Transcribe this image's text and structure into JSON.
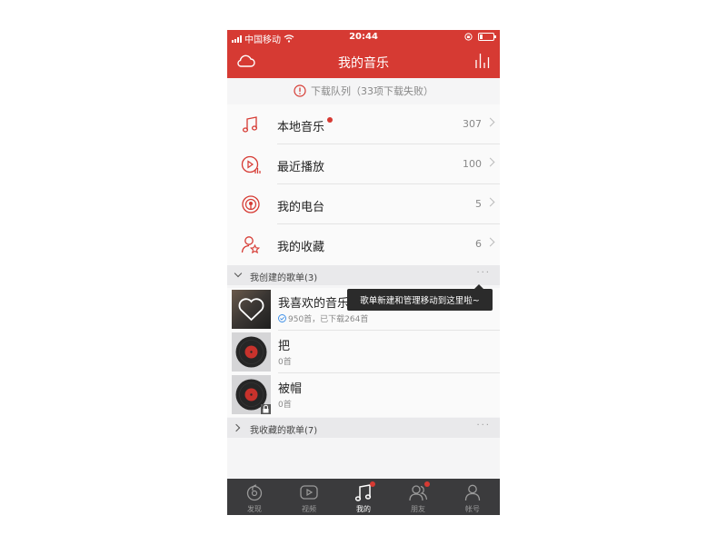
{
  "status_bar": {
    "carrier": "中国移动",
    "time": "20:44"
  },
  "nav": {
    "title": "我的音乐"
  },
  "download_queue": {
    "text": "下载队列（33项下载失败）"
  },
  "menu": [
    {
      "label": "本地音乐",
      "count": "307",
      "icon": "music-note-icon"
    },
    {
      "label": "最近播放",
      "count": "100",
      "icon": "recent-play-icon"
    },
    {
      "label": "我的电台",
      "count": "5",
      "icon": "radio-icon"
    },
    {
      "label": "我的收藏",
      "count": "6",
      "icon": "favorite-user-icon"
    }
  ],
  "created_section": {
    "title": "我创建的歌单(3)",
    "more": "···"
  },
  "tooltip": {
    "text": "歌单新建和管理移动到这里啦~"
  },
  "playlists": [
    {
      "name": "我喜欢的音乐",
      "sub": "950首，已下载264首"
    },
    {
      "name": "把",
      "sub": "0首"
    },
    {
      "name": "被帽",
      "sub": "0首"
    }
  ],
  "collected_section": {
    "title": "我收藏的歌单(7)",
    "more": "···"
  },
  "tabs": [
    {
      "label": "发现",
      "icon": "discover-icon",
      "active": false
    },
    {
      "label": "视频",
      "icon": "video-icon",
      "active": false
    },
    {
      "label": "我的",
      "icon": "music-icon",
      "active": true
    },
    {
      "label": "朋友",
      "icon": "friends-icon",
      "active": false
    },
    {
      "label": "帐号",
      "icon": "account-icon",
      "active": false
    }
  ],
  "colors": {
    "accent": "#d63a33",
    "tabbar": "#3b3b3d"
  }
}
